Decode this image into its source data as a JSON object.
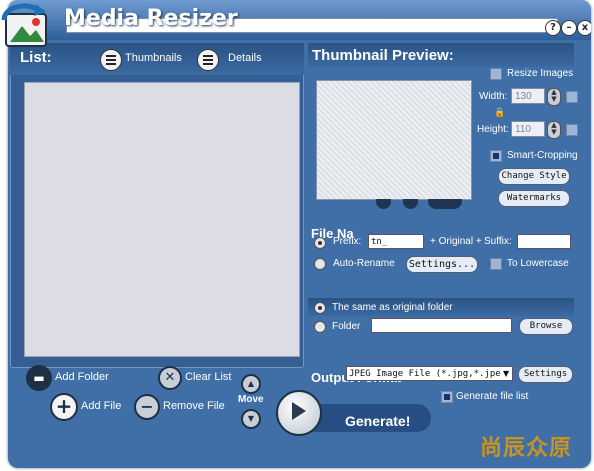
{
  "app": {
    "title": "Media Resizer"
  },
  "titlebar_buttons": {
    "help": "?",
    "minimize": "–",
    "close": "x"
  },
  "list": {
    "label": "List:",
    "view_thumbnails": "Thumbnails",
    "view_details": "Details"
  },
  "list_actions": {
    "add_folder": "Add Folder",
    "add_file": "Add File",
    "clear_list": "Clear List",
    "remove_file": "Remove File",
    "move": "Move",
    "generate": "Generate!"
  },
  "thumbnail": {
    "title": "Thumbnail Preview:",
    "resize_images": "Resize Images",
    "width_label": "Width:",
    "width_value": "130",
    "height_label": "Height:",
    "height_value": "110",
    "smart_cropping": "Smart-Cropping",
    "change_style": "Change Style",
    "watermarks": "Watermarks"
  },
  "file_name": {
    "header": "File Na",
    "prefix_label": "Prefix:",
    "prefix_value": "tn_",
    "original_label": "+ Original +",
    "suffix_label": "Suffix:",
    "suffix_value": "",
    "auto_rename": "Auto-Rename",
    "settings": "Settings...",
    "to_lowercase": "To Lowercase"
  },
  "output_folder": {
    "same_as_original": "The same as original folder",
    "folder_label": "Folder",
    "folder_value": "",
    "browse": "Browse"
  },
  "output_format": {
    "header": "Output Format",
    "format_value": "JPEG Image File (*.jpg,*.jpe",
    "settings": "Settings",
    "generate_file_list": "Generate file list"
  },
  "watermark": {
    "text": "尚辰众原"
  },
  "colors": {
    "window_blue": "#3f6fa6",
    "accent_orange": "#c8931e"
  }
}
